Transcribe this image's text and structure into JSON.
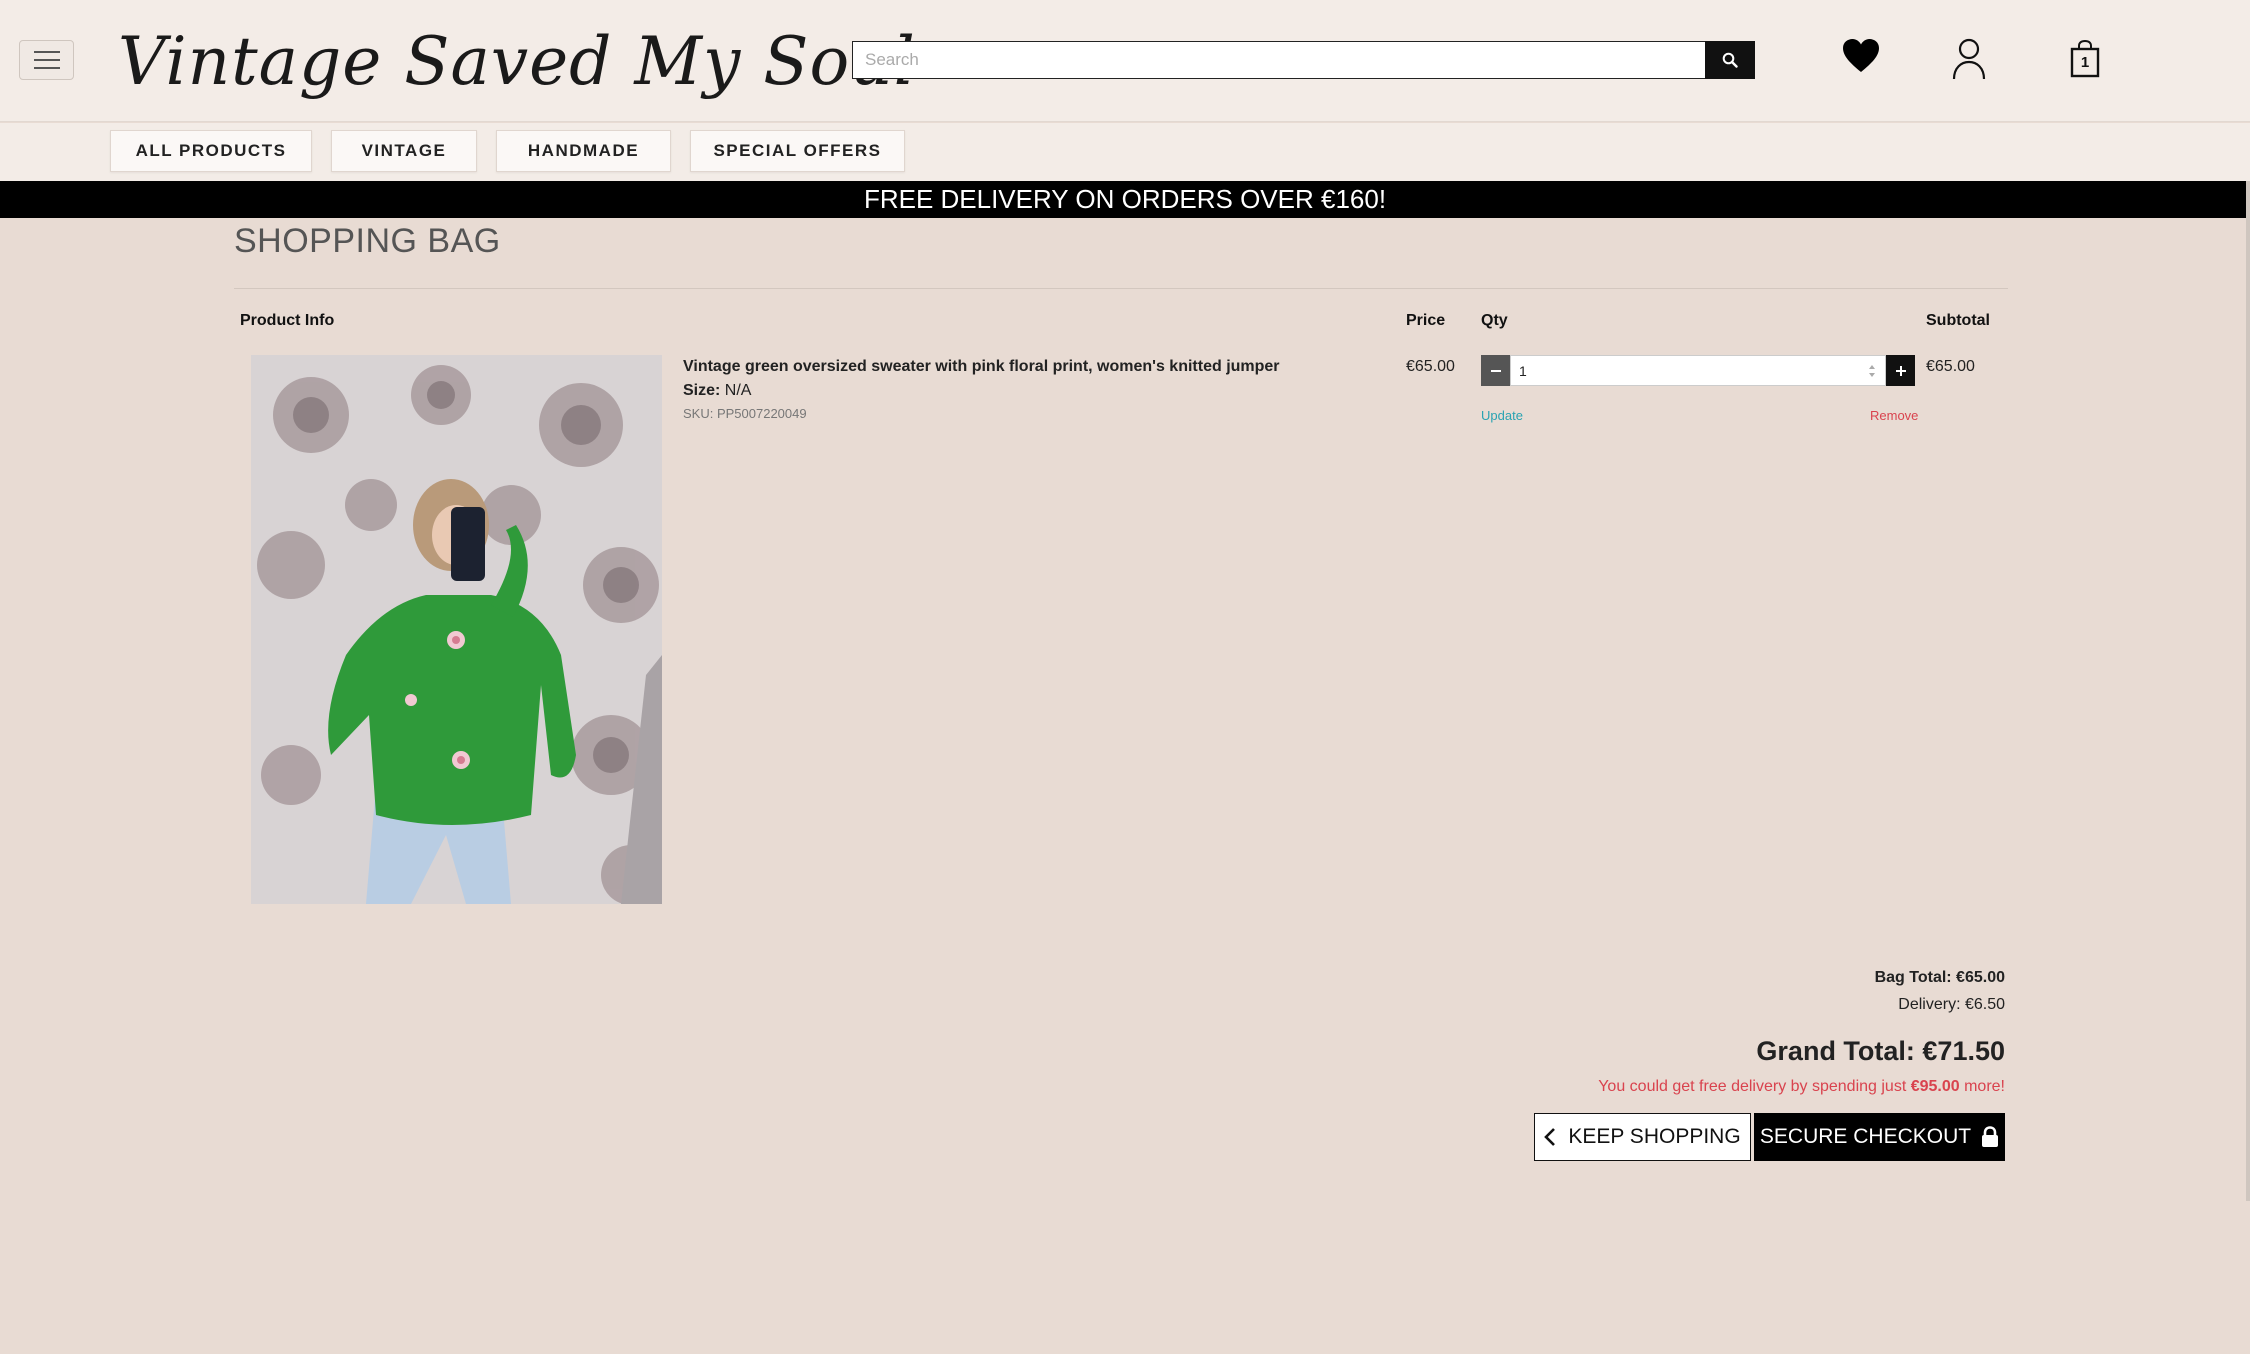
{
  "header": {
    "logo_text": "Vintage Saved My Soul",
    "search_placeholder": "Search",
    "bag_count": "1"
  },
  "nav": {
    "items": [
      {
        "label": "ALL PRODUCTS"
      },
      {
        "label": "VINTAGE"
      },
      {
        "label": "HANDMADE"
      },
      {
        "label": "SPECIAL OFFERS"
      }
    ]
  },
  "banner": {
    "text": "FREE DELIVERY ON ORDERS OVER €160!"
  },
  "page": {
    "title": "SHOPPING BAG"
  },
  "table": {
    "headers": {
      "product_info": "Product Info",
      "price": "Price",
      "qty": "Qty",
      "subtotal": "Subtotal"
    }
  },
  "item": {
    "name": "Vintage green oversized sweater with pink floral print, women's knitted jumper",
    "size_label": "Size:",
    "size_value": "N/A",
    "sku": "SKU: PP5007220049",
    "price": "€65.00",
    "qty": "1",
    "update_label": "Update",
    "remove_label": "Remove",
    "subtotal": "€65.00"
  },
  "totals": {
    "bag_total": "Bag Total: €65.00",
    "delivery": "Delivery: €6.50",
    "grand_total": "Grand Total: €71.50",
    "free_note_prefix": "You could get free delivery by spending just ",
    "free_note_amount": "€95.00",
    "free_note_suffix": " more!"
  },
  "actions": {
    "keep_shopping": "KEEP SHOPPING",
    "secure_checkout": "SECURE CHECKOUT"
  },
  "icons": {
    "menu": "hamburger-icon",
    "search": "search-icon",
    "wishlist": "heart-icon",
    "account": "user-icon",
    "bag": "shopping-bag-icon",
    "back": "chevron-left-icon",
    "lock": "lock-icon"
  },
  "colors": {
    "page_bg": "#e8dbd3",
    "header_bg": "#f3ece7",
    "banner_bg": "#000000",
    "link_update": "#2aa3b2",
    "link_remove": "#d9434e"
  }
}
